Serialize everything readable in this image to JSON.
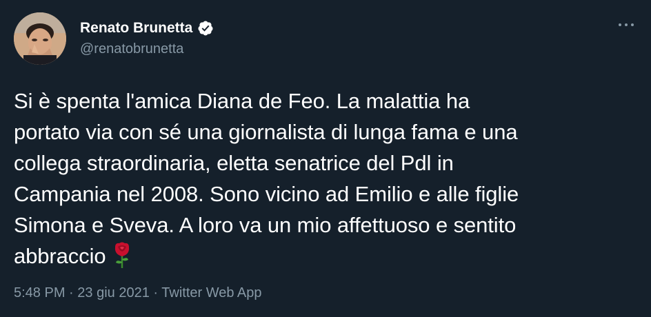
{
  "author": {
    "display_name": "Renato Brunetta",
    "handle": "@renatobrunetta",
    "verified_icon": "verified-badge-icon",
    "avatar_icon": "avatar-photo"
  },
  "menu": {
    "more_icon": "more-options-icon"
  },
  "tweet": {
    "lines": [
      "Si è spenta l'amica Diana de Feo. La malattia ha",
      "portato via con sé una giornalista di lunga fama e una",
      "collega straordinaria, eletta senatrice del Pdl in",
      "Campania nel 2008. Sono vicino ad Emilio e alle figlie",
      "Simona e Sveva. A loro va un mio affettuoso e sentito",
      "abbraccio"
    ],
    "emoji_icon": "rose-icon"
  },
  "meta": {
    "time": "5:48 PM",
    "separator": "·",
    "date": "23 giu 2021",
    "source": "Twitter Web App"
  },
  "colors": {
    "background": "#15202b",
    "text": "#ffffff",
    "secondary": "#8899a6"
  }
}
